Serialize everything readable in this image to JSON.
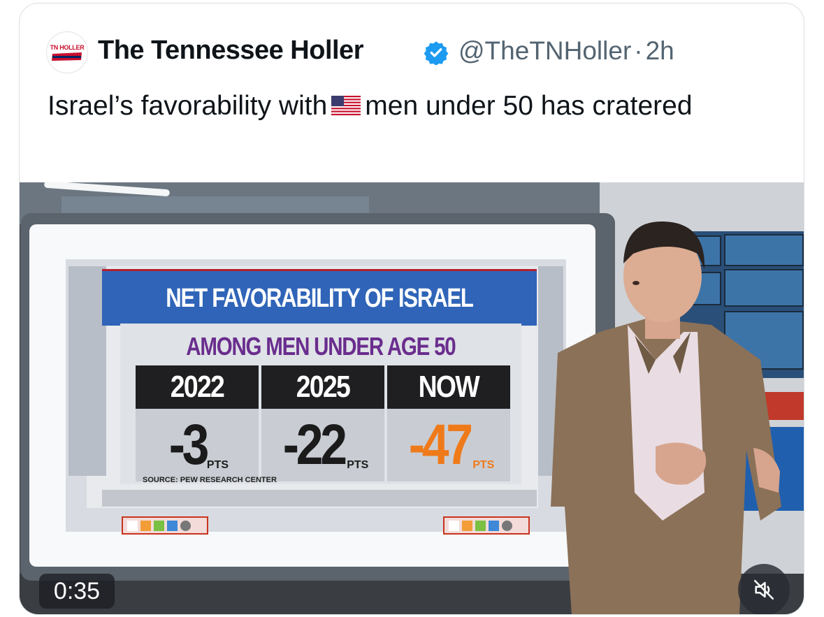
{
  "tweet": {
    "display_name": "The Tennessee Holler",
    "handle": "@TheTNHoller",
    "separator": "·",
    "time_ago": "2h",
    "avatar_text": "TN HOLLER",
    "text_before_flag": "Israel’s favorability with",
    "text_after_flag": "men under 50 has cratered",
    "flag_icon": "us-flag-icon",
    "verified_color": "#1d9bf0"
  },
  "video": {
    "timestamp": "0:35",
    "muted": true,
    "graphic": {
      "title": "NET FAVORABILITY OF ISRAEL",
      "subtitle": "AMONG MEN UNDER AGE 50",
      "columns": [
        {
          "label": "2022",
          "value": "-3",
          "unit": "PTS"
        },
        {
          "label": "2025",
          "value": "-22",
          "unit": "PTS"
        },
        {
          "label": "NOW",
          "value": "-47",
          "unit": "PTS"
        }
      ],
      "source": "SOURCE: PEW RESEARCH CENTER",
      "highlight_color": "#ef7a1a"
    }
  }
}
